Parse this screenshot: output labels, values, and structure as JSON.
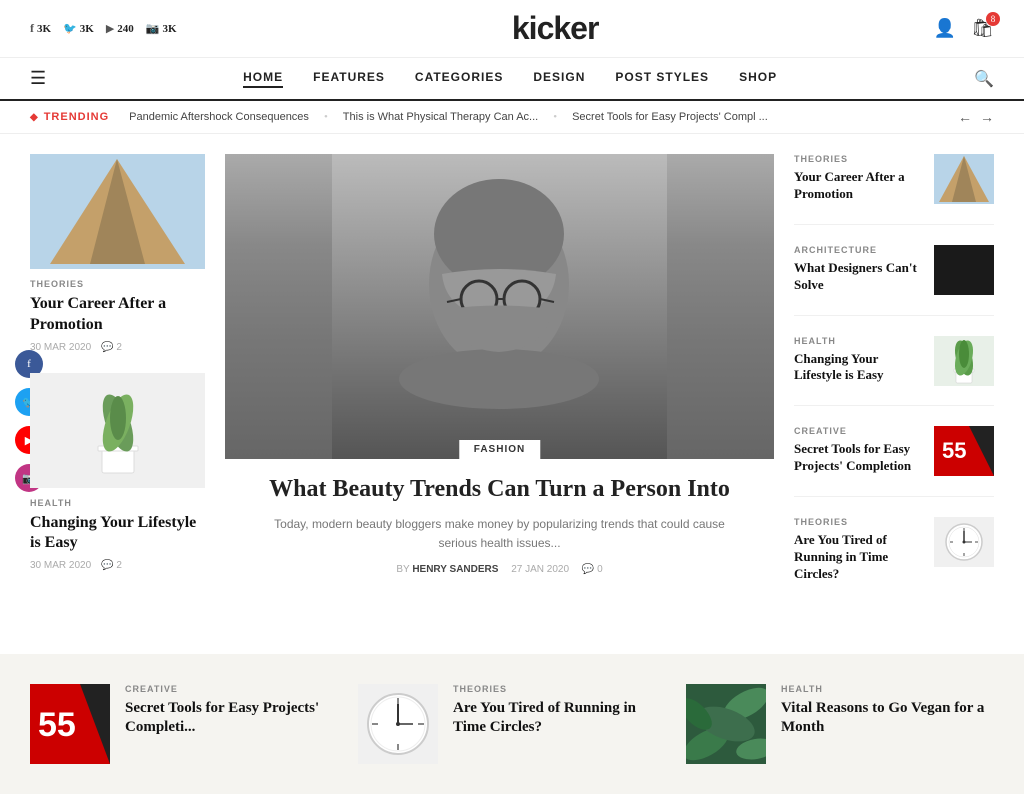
{
  "site": {
    "logo": "kicker"
  },
  "topbar": {
    "social": [
      {
        "icon": "f",
        "platform": "facebook",
        "count": "3K"
      },
      {
        "icon": "t",
        "platform": "twitter",
        "count": "3K"
      },
      {
        "icon": "▶",
        "platform": "youtube",
        "count": "240"
      },
      {
        "icon": "◻",
        "platform": "instagram",
        "count": "3K"
      }
    ],
    "cart_count": "8"
  },
  "nav": {
    "items": [
      {
        "label": "HOME",
        "active": true
      },
      {
        "label": "FEATURES",
        "active": false
      },
      {
        "label": "CATEGORIES",
        "active": false
      },
      {
        "label": "DESIGN",
        "active": false
      },
      {
        "label": "POST STYLES",
        "active": false
      },
      {
        "label": "SHOP",
        "active": false
      }
    ]
  },
  "trending": {
    "label": "TRENDING",
    "items": [
      "Pandemic Aftershock Consequences",
      "This is What Physical Therapy Can Ac...",
      "Secret Tools for Easy Projects' Compl ..."
    ]
  },
  "left_cards": [
    {
      "category": "THEORIES",
      "title": "Your Career After a Promotion",
      "date": "30 MAR 2020",
      "comments": "2"
    },
    {
      "category": "HEALTH",
      "title": "Changing Your Lifestyle is Easy",
      "date": "30 MAR 2020",
      "comments": "2"
    }
  ],
  "center": {
    "category": "FASHION",
    "title": "What Beauty Trends Can Turn a Person Into",
    "excerpt": "Today, modern beauty bloggers make money by popularizing trends that could cause serious health issues...",
    "by_label": "BY",
    "author": "HENRY SANDERS",
    "date": "27 JAN 2020",
    "comments": "0"
  },
  "right_cards": [
    {
      "category": "THEORIES",
      "title": "Your Career After a Promotion",
      "img_type": "geo"
    },
    {
      "category": "ARCHITECTURE",
      "title": "What Designers Can't Solve",
      "img_type": "dark"
    },
    {
      "category": "HEALTH",
      "title": "Changing Your Lifestyle is Easy",
      "img_type": "plant"
    },
    {
      "category": "CREATIVE",
      "title": "Secret Tools for Easy Projects' Completion",
      "img_type": "red"
    },
    {
      "category": "THEORIES",
      "title": "Are You Tired of Running in Time Circles?",
      "img_type": "clock"
    }
  ],
  "bottom_cards": [
    {
      "category": "CREATIVE",
      "title": "Secret Tools for Easy Projects' Completi...",
      "img_type": "red"
    },
    {
      "category": "THEORIES",
      "title": "Are You Tired of Running in Time Circles?",
      "img_type": "clock"
    },
    {
      "category": "HEALTH",
      "title": "Vital Reasons to Go Vegan for a Month",
      "img_type": "green"
    }
  ],
  "social_sidebar": [
    {
      "icon": "f",
      "platform": "facebook"
    },
    {
      "icon": "t",
      "platform": "twitter"
    },
    {
      "icon": "▶",
      "platform": "youtube"
    },
    {
      "icon": "◻",
      "platform": "instagram"
    }
  ]
}
